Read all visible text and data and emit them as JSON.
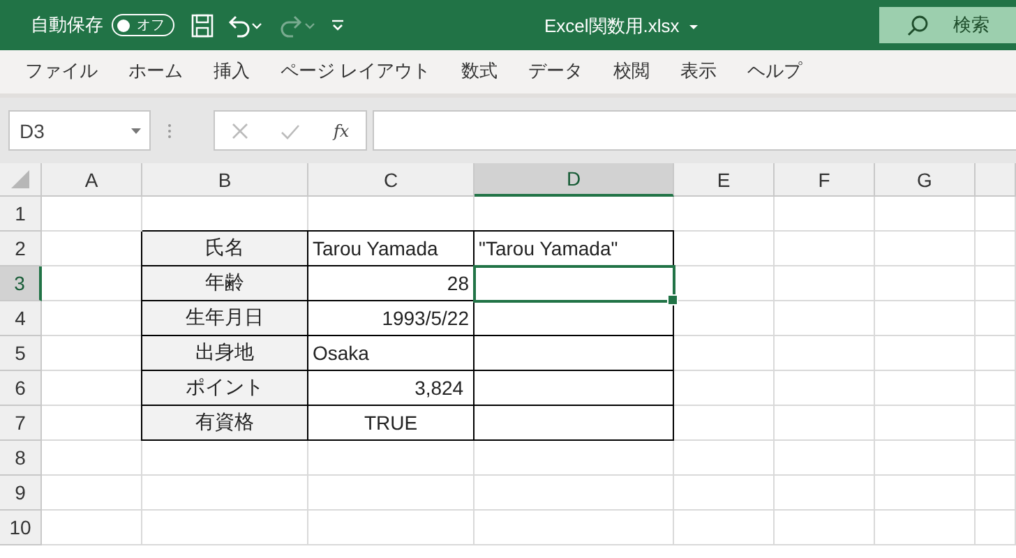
{
  "title_bar": {
    "autosave": {
      "label": "自動保存",
      "toggle_text": "オフ",
      "on": false
    },
    "undo": {
      "disabled": false
    },
    "redo": {
      "disabled": true
    },
    "title": "Excel関数用.xlsx",
    "search": {
      "placeholder": "検索"
    }
  },
  "ribbon_tabs": [
    "ファイル",
    "ホーム",
    "挿入",
    "ページ レイアウト",
    "数式",
    "データ",
    "校閲",
    "表示",
    "ヘルプ"
  ],
  "formula_bar": {
    "name_box": "D3",
    "function_label": "fx"
  },
  "sheet": {
    "columns": [
      {
        "label": "A",
        "selected": false
      },
      {
        "label": "B",
        "selected": false
      },
      {
        "label": "C",
        "selected": false
      },
      {
        "label": "D",
        "selected": true
      },
      {
        "label": "E",
        "selected": false
      },
      {
        "label": "F",
        "selected": false
      },
      {
        "label": "G",
        "selected": false
      }
    ],
    "rows": [
      {
        "label": "1",
        "selected": false,
        "cells": []
      },
      {
        "label": "2",
        "selected": false,
        "cells": [
          null,
          {
            "kind": "label",
            "text": "氏名"
          },
          {
            "kind": "text",
            "text": "Tarou Yamada"
          },
          {
            "kind": "text",
            "text": "\"Tarou Yamada\""
          }
        ]
      },
      {
        "label": "3",
        "selected": true,
        "cells": [
          null,
          {
            "kind": "label",
            "text": "年齢"
          },
          {
            "kind": "number",
            "text": "28"
          },
          {
            "kind": "blank"
          }
        ]
      },
      {
        "label": "4",
        "selected": false,
        "cells": [
          null,
          {
            "kind": "label",
            "text": "生年月日"
          },
          {
            "kind": "number",
            "text": "1993/5/22"
          },
          {
            "kind": "blank"
          }
        ]
      },
      {
        "label": "5",
        "selected": false,
        "cells": [
          null,
          {
            "kind": "label",
            "text": "出身地"
          },
          {
            "kind": "text",
            "text": "Osaka"
          },
          {
            "kind": "blank"
          }
        ]
      },
      {
        "label": "6",
        "selected": false,
        "cells": [
          null,
          {
            "kind": "label",
            "text": "ポイント"
          },
          {
            "kind": "number",
            "text": "3,824 "
          },
          {
            "kind": "blank"
          }
        ]
      },
      {
        "label": "7",
        "selected": false,
        "cells": [
          null,
          {
            "kind": "label",
            "text": "有資格"
          },
          {
            "kind": "boolean",
            "text": "TRUE"
          },
          {
            "kind": "blank"
          }
        ]
      },
      {
        "label": "8",
        "selected": false,
        "cells": []
      },
      {
        "label": "9",
        "selected": false,
        "cells": []
      },
      {
        "label": "10",
        "selected": false,
        "cells": []
      }
    ]
  }
}
